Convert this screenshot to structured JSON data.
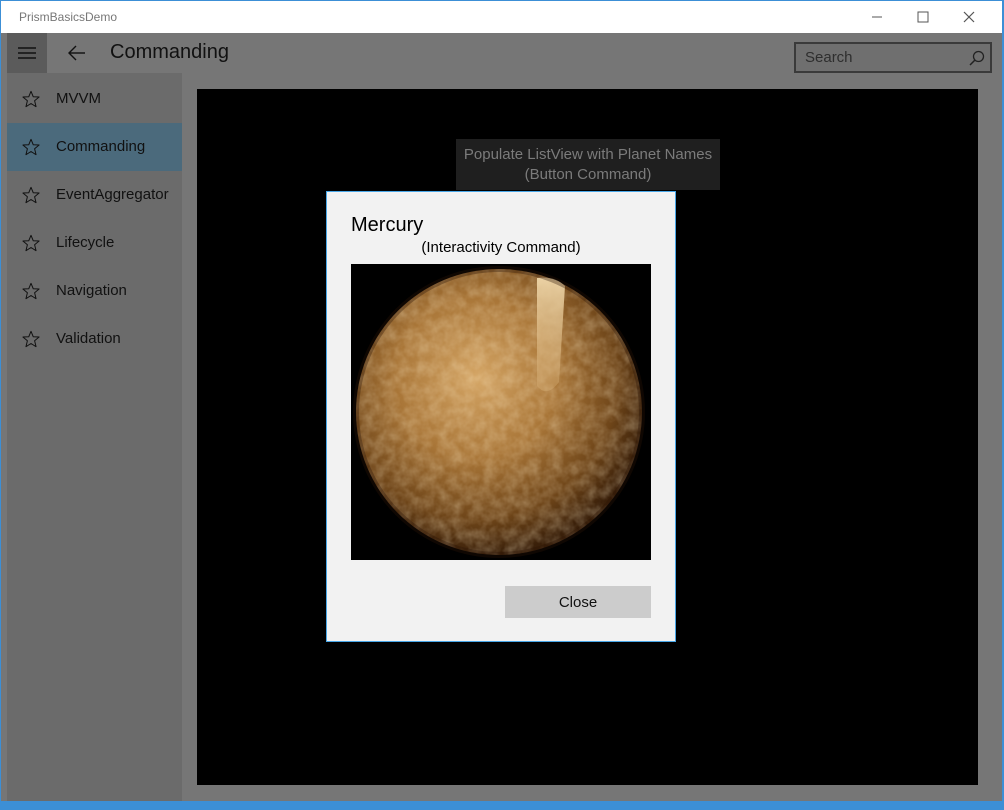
{
  "window": {
    "title": "PrismBasicsDemo",
    "controls": [
      "minimize-icon",
      "maximize-icon",
      "close-icon"
    ]
  },
  "header": {
    "menu_icon": "hamburger-icon",
    "back_icon": "back-arrow-icon",
    "page_title": "Commanding",
    "search": {
      "placeholder": "Search",
      "value": "",
      "icon": "search-icon"
    }
  },
  "sidebar": {
    "items": [
      {
        "label": "MVVM",
        "icon": "star-icon",
        "selected": false
      },
      {
        "label": "Commanding",
        "icon": "star-icon",
        "selected": true
      },
      {
        "label": "EventAggregator",
        "icon": "star-icon",
        "selected": false
      },
      {
        "label": "Lifecycle",
        "icon": "star-icon",
        "selected": false
      },
      {
        "label": "Navigation",
        "icon": "star-icon",
        "selected": false
      },
      {
        "label": "Validation",
        "icon": "star-icon",
        "selected": false
      }
    ]
  },
  "main": {
    "populate_button": {
      "line1": "Populate ListView with Planet Names",
      "line2": "(Button Command)"
    }
  },
  "dialog": {
    "title": "Mercury",
    "subtitle": "(Interactivity Command)",
    "image": "mercury-planet-image",
    "close_label": "Close"
  },
  "colors": {
    "accent": "#49a7e8",
    "selected_nav": "#4b6a7c",
    "chrome": "#767676",
    "content_bg": "#000000"
  }
}
